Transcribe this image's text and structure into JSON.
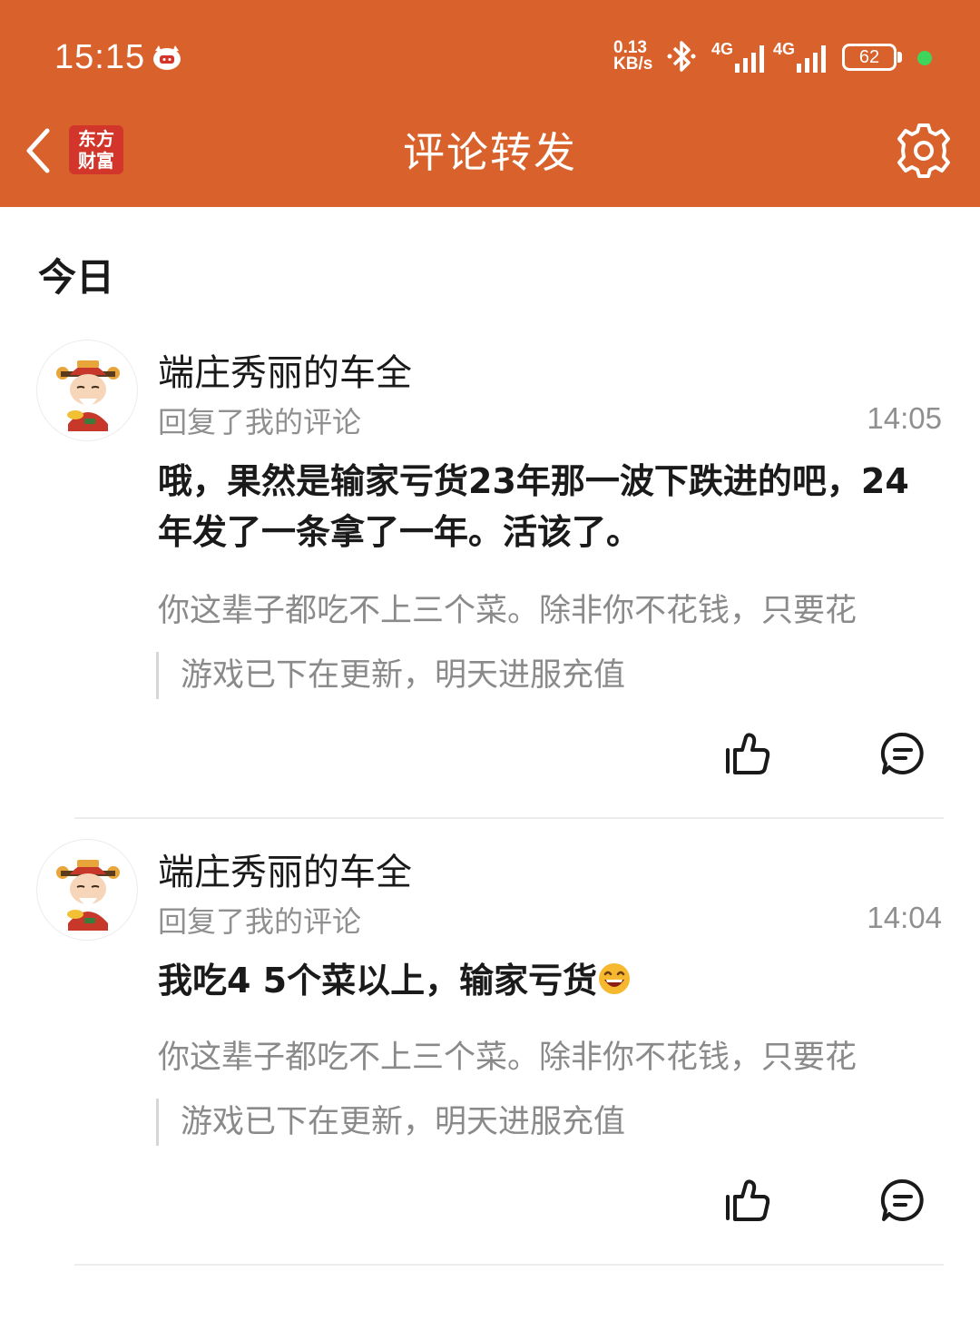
{
  "status_bar": {
    "time": "15:15",
    "net_speed_value": "0.13",
    "net_speed_unit": "KB/s",
    "signal1_label": "4G",
    "signal2_label": "4G",
    "battery": "62",
    "icons": [
      "notification-pig-icon",
      "bluetooth-icon",
      "signal-icon",
      "battery-icon"
    ]
  },
  "header": {
    "logo_line1": "东方",
    "logo_line2": "财富",
    "title": "评论转发",
    "icons": [
      "back-arrow-icon",
      "settings-gear-icon"
    ],
    "accent_color": "#d9612b"
  },
  "section_title": "今日",
  "items": [
    {
      "user_name": "端庄秀丽的车全",
      "action": "回复了我的评论",
      "time": "14:05",
      "content": "哦，果然是输家亏货23年那一波下跌进的吧，24年发了一条拿了一年。活该了。",
      "content_emoji": "",
      "original_comment": "你这辈子都吃不上三个菜。除非你不花钱，只要花",
      "quoted_post": "游戏已下在更新，明天进服充值"
    },
    {
      "user_name": "端庄秀丽的车全",
      "action": "回复了我的评论",
      "time": "14:04",
      "content": "我吃4 5个菜以上，输家亏货",
      "content_emoji": "laughing-emoji",
      "original_comment": "你这辈子都吃不上三个菜。除非你不花钱，只要花",
      "quoted_post": "游戏已下在更新，明天进服充值"
    }
  ]
}
